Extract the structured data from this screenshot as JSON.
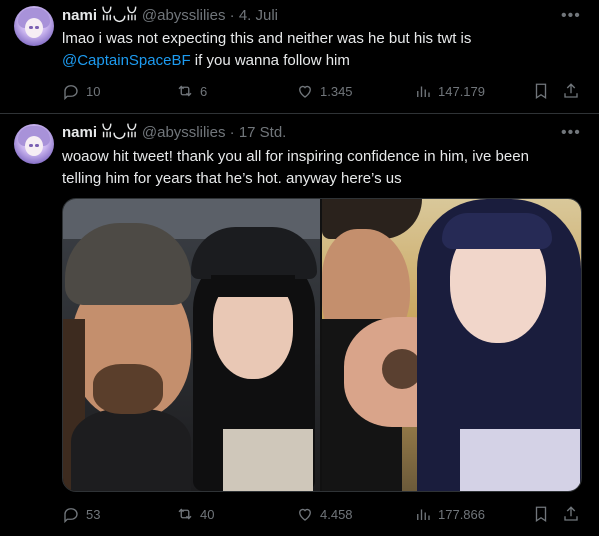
{
  "tweets": [
    {
      "name": "nami ꈍ◡ꈍ",
      "handle": "@abysslilies",
      "sep": "·",
      "time": "4. Juli",
      "text_plain": "lmao i was not expecting this and neither was he but his twt is",
      "mention": "@CaptainSpaceBF",
      "text_after": " if you wanna follow him",
      "stats": {
        "replies": "10",
        "reposts": "6",
        "likes": "1.345",
        "views": "147.179"
      }
    },
    {
      "name": "nami ꈍ◡ꈍ",
      "handle": "@abysslilies",
      "sep": "·",
      "time": "17 Std.",
      "text_line1": "woaow hit tweet! thank you all for inspiring confidence in him, ive been",
      "text_line2": "telling him for years that he’s hot. anyway here’s us",
      "stats": {
        "replies": "53",
        "reposts": "40",
        "likes": "4.458",
        "views": "177.866"
      }
    }
  ],
  "icons": {
    "more": "more-icon",
    "reply": "reply-icon",
    "repost": "repost-icon",
    "like": "like-icon",
    "views": "views-icon",
    "bookmark": "bookmark-icon",
    "share": "share-icon"
  },
  "colors": {
    "background": "#000000",
    "text": "#e7e9ea",
    "muted": "#71767b",
    "link": "#1d9bf0",
    "divider": "#2f3336"
  }
}
